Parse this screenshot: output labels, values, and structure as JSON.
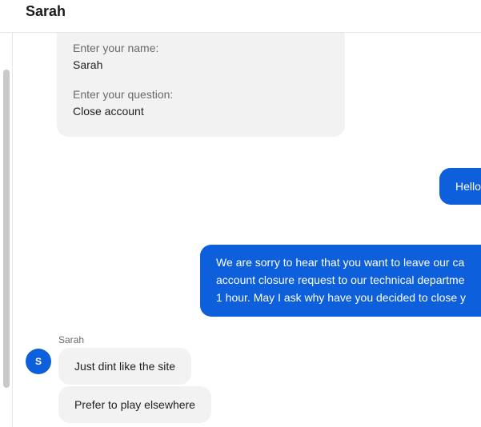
{
  "header": {
    "title": "Sarah"
  },
  "form": {
    "fields": [
      {
        "label": "Enter your name:",
        "value": "Sarah"
      },
      {
        "label": "Enter your question:",
        "value": "Close account"
      }
    ]
  },
  "messages": {
    "outgoing": [
      {
        "lines": [
          "Hello"
        ]
      },
      {
        "lines": [
          "We are sorry to hear that you want to leave our ca",
          "account closure request to our technical departme",
          "1 hour. May I ask why have you decided to close y"
        ]
      }
    ],
    "incoming_group": {
      "sender": "Sarah",
      "avatar_initial": "S",
      "messages": [
        "Just dint like the site",
        "Prefer to play elsewhere"
      ]
    }
  },
  "colors": {
    "accent": "#0d5fdc",
    "bubble_gray": "#f2f2f2"
  }
}
